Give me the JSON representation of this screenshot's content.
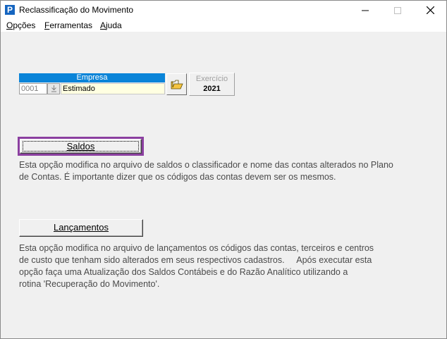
{
  "window": {
    "title": "Reclassificação do Movimento",
    "app_icon_letter": "P",
    "controls": [
      "minimize",
      "maximize",
      "close"
    ]
  },
  "menu": {
    "items": [
      {
        "pre": "",
        "key": "O",
        "post": "pções"
      },
      {
        "pre": "",
        "key": "F",
        "post": "erramentas"
      },
      {
        "pre": "",
        "key": "A",
        "post": "juda"
      }
    ]
  },
  "empresa": {
    "header": "Empresa",
    "code": "0001",
    "name": "Estimado",
    "folder_icon": "open-folder-icon"
  },
  "exercicio": {
    "label": "Exercício",
    "value": "2021"
  },
  "saldos": {
    "button_label": "Saldos",
    "description_lines": [
      "Esta opção modifica no arquivo de saldos o classificador e nome das contas alterados no Plano",
      "de Contas. É importante dizer que os códigos das contas devem ser os mesmos."
    ]
  },
  "lancamentos": {
    "button_label": "Lançamentos",
    "description_lines": [
      "Esta opção modifica no arquivo de lançamentos os códigos das contas, terceiros e centros",
      "de custo que tenham sido alterados em seus respectivos cadastros.     Após executar esta",
      "opção faça uma Atualização dos Saldos Contábeis e do Razão Analítico utilizando a",
      "rotina 'Recuperação do Movimento'."
    ]
  },
  "colors": {
    "header_blue": "#0a84d8",
    "focus_purple": "#8b3fa0",
    "name_field_bg": "#ffffe1"
  }
}
